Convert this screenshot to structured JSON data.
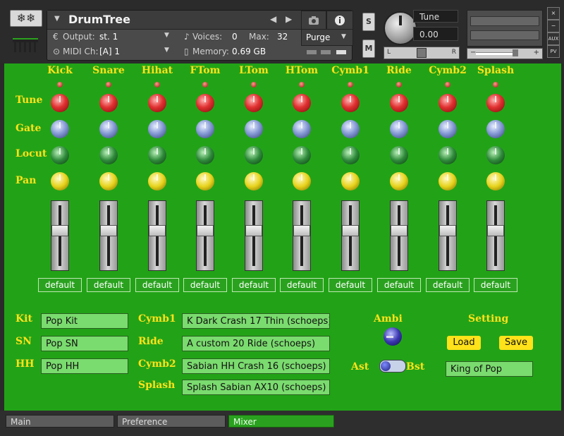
{
  "header": {
    "instrument_name": "DrumTree",
    "output_label": "Output:",
    "output_value": "st. 1",
    "voices_label": "Voices:",
    "voices_value": "0",
    "max_label": "Max:",
    "max_value": "32",
    "purge_label": "Purge",
    "midi_label": "MIDI Ch:",
    "midi_value": "[A]  1",
    "memory_label": "Memory:",
    "memory_value": "0.69 GB",
    "solo_label": "S",
    "mute_label": "M",
    "tune_label": "Tune",
    "tune_value": "0.00",
    "pan_left": "L",
    "pan_right": "R",
    "vol_minus": "−",
    "vol_plus": "+",
    "close_label": "×",
    "min_label": "−",
    "aux_label": "AUX",
    "pv_label": "PV"
  },
  "mixer": {
    "channels": [
      "Kick",
      "Snare",
      "Hihat",
      "FTom",
      "LTom",
      "HTom",
      "Cymb1",
      "Ride",
      "Cymb2",
      "Splash"
    ],
    "row_labels": {
      "tune": "Tune",
      "gate": "Gate",
      "locut": "Locut",
      "pan": "Pan"
    },
    "preset_label": "default",
    "fader_levels": [
      0.6,
      0.6,
      0.6,
      0.6,
      0.6,
      0.6,
      0.6,
      0.6,
      0.6,
      0.6
    ]
  },
  "kit": {
    "kit_label": "Kit",
    "kit_value": "Pop Kit",
    "sn_label": "SN",
    "sn_value": "Pop SN",
    "hh_label": "HH",
    "hh_value": "Pop HH",
    "cymb1_label": "Cymb1",
    "cymb1_value": "K Dark Crash 17 Thin (schoeps)",
    "ride_label": "Ride",
    "ride_value": "A custom 20 Ride (schoeps)",
    "cymb2_label": "Cymb2",
    "cymb2_value": "Sabian HH Crash 16 (schoeps)",
    "splash_label": "Splash",
    "splash_value": "Splash Sabian AX10 (schoeps)"
  },
  "ambi": {
    "label": "Ambi",
    "ast_label": "Ast",
    "bst_label": "Bst"
  },
  "setting": {
    "label": "Setting",
    "load_label": "Load",
    "save_label": "Save",
    "preset_name": "King of Pop"
  },
  "tabs": [
    {
      "label": "Main"
    },
    {
      "label": "Preference"
    },
    {
      "label": "Mixer"
    }
  ],
  "colors": {
    "panel": "#22a317",
    "label_yellow": "#ffe21a",
    "field_green": "#7adb6e"
  }
}
